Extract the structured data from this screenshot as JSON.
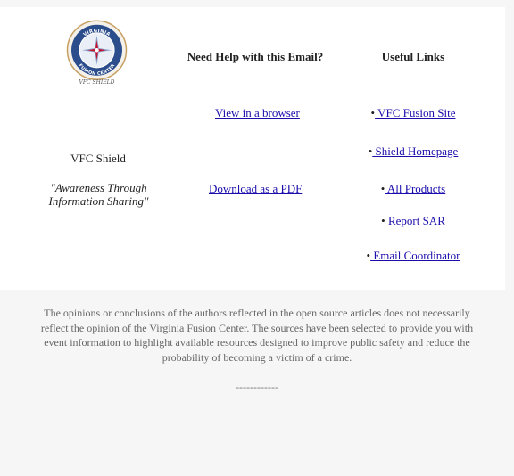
{
  "logo": {
    "top_text": "VIRGINIA",
    "bottom_text": "FUSION CENTER",
    "script_text": "VFC SHIELD"
  },
  "headers": {
    "help": "Need Help with this Email?",
    "links": "Useful Links"
  },
  "help_links": {
    "browser": "View in a browser",
    "pdf": "Download as a PDF"
  },
  "useful_links": [
    {
      "bullet": "•",
      "label": " VFC Fusion Site"
    },
    {
      "bullet": "•",
      "label": " Shield Homepage"
    },
    {
      "bullet": "•",
      "label": " All Products"
    },
    {
      "bullet": "•",
      "label": " Report SAR"
    },
    {
      "bullet": "•",
      "label": " Email Coordinator"
    }
  ],
  "brand": {
    "name": "VFC Shield",
    "tagline": "\"Awareness Through Information Sharing\""
  },
  "disclaimer": "The opinions or conclusions of the authors reflected in the open source articles does not necessarily reflect the opinion of the Virginia Fusion Center. The sources have been selected to provide you with event information to highlight available resources designed to improve public safety and reduce the probability of becoming a victim of a crime.",
  "separator": "------------",
  "colors": {
    "link": "#1a0dab",
    "logo_blue": "#2b4d8c",
    "logo_ring": "#c7a062"
  }
}
